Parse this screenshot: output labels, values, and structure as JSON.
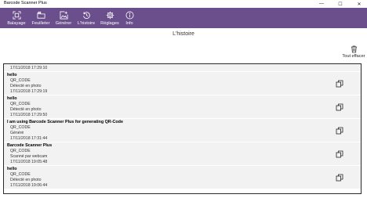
{
  "window": {
    "title": "Barcode Scanner Plus",
    "minimize_glyph": "—",
    "maximize_glyph": "☐",
    "close_glyph": "✕"
  },
  "toolbar": {
    "background": "#6a4f8c",
    "items": [
      {
        "label": "Balayage",
        "icon": "scan-icon"
      },
      {
        "label": "Feuilleter",
        "icon": "folder-icon"
      },
      {
        "label": "Générer",
        "icon": "add-image-icon"
      },
      {
        "label": "L'histoire",
        "icon": "history-icon"
      },
      {
        "label": "Réglages",
        "icon": "gear-icon"
      },
      {
        "label": "Info",
        "icon": "info-icon"
      }
    ]
  },
  "page": {
    "title": "L'histoire"
  },
  "clear_all": {
    "label": "Tout effacer",
    "icon": "trash-icon"
  },
  "history": [
    {
      "timestamp": "17/11/2018 17:29:10"
    },
    {
      "content": "hello",
      "type": "QR_CODE",
      "source": "Détecté en photo",
      "timestamp": "17/11/2018 17:29:19"
    },
    {
      "content": "hello",
      "type": "QR_CODE",
      "source": "Détecté en photo",
      "timestamp": "17/11/2018 17:29:50"
    },
    {
      "content": "I am using Barcode Scanner Plus for generating QR-Code",
      "type": "QR_CODE",
      "source": "Généré",
      "timestamp": "17/11/2018 17:31:44"
    },
    {
      "content": "Barcode Scanner Plus",
      "type": "QR_CODE",
      "source": "Scanné par webcam",
      "timestamp": "17/11/2018 19:05:48"
    },
    {
      "content": "hello",
      "type": "QR_CODE",
      "source": "Détecté en photo",
      "timestamp": "17/11/2018 19:06:44"
    }
  ]
}
